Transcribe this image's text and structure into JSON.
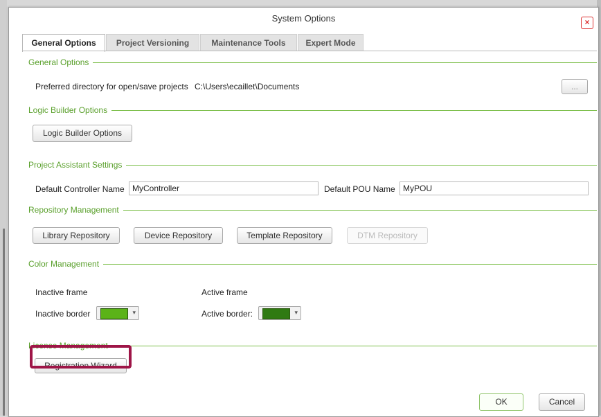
{
  "window": {
    "title": "System Options"
  },
  "tabs": [
    {
      "label": "General Options",
      "active": true
    },
    {
      "label": "Project Versioning"
    },
    {
      "label": "Maintenance Tools"
    },
    {
      "label": "Expert Mode"
    }
  ],
  "sections": {
    "general": {
      "title": "General Options",
      "dir_label": "Preferred directory for open/save projects",
      "dir_value": "C:\\Users\\ecaillet\\Documents",
      "browse_label": "..."
    },
    "logic": {
      "title": "Logic Builder Options",
      "button": "Logic Builder Options"
    },
    "assistant": {
      "title": "Project Assistant Settings",
      "controller_label": "Default Controller Name",
      "controller_value": "MyController",
      "pou_label": "Default POU Name",
      "pou_value": "MyPOU"
    },
    "repository": {
      "title": "Repository Management",
      "buttons": [
        "Library Repository",
        "Device Repository",
        "Template Repository",
        "DTM Repository"
      ]
    },
    "color": {
      "title": "Color Management",
      "inactive_frame": "Inactive frame",
      "active_frame": "Active frame",
      "inactive_border": "Inactive border",
      "active_border": "Active border:",
      "inactive_color": "#5bb318",
      "active_color": "#2f7a12"
    },
    "license": {
      "title": "License Management",
      "button": "Registration Wizard"
    }
  },
  "footer": {
    "ok": "OK",
    "cancel": "Cancel"
  },
  "colors": {
    "accent_green": "#5aa02c",
    "highlight": "#9e1547"
  }
}
